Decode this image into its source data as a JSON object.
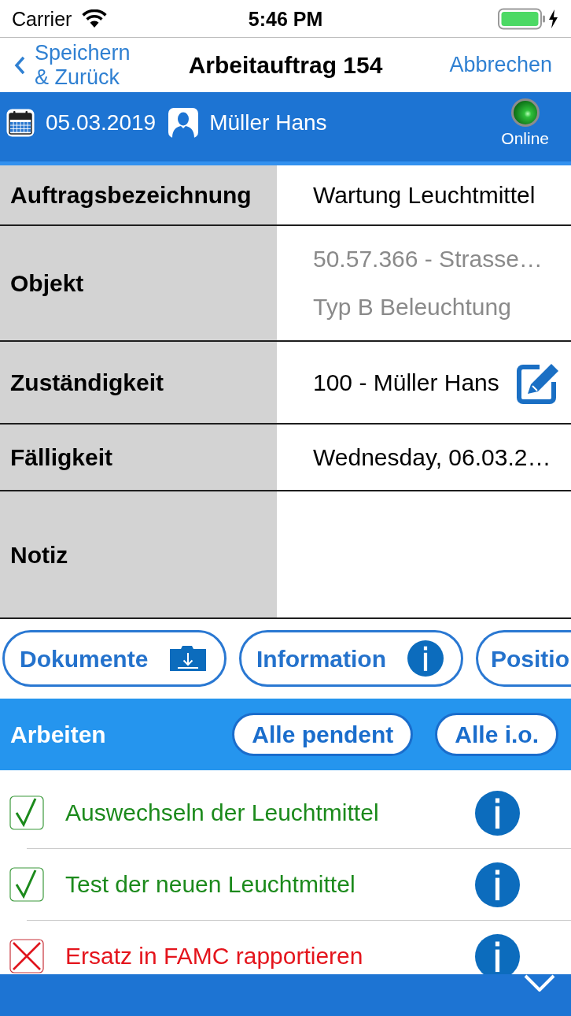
{
  "status_bar": {
    "carrier": "Carrier",
    "time": "5:46 PM"
  },
  "nav": {
    "back": "Speichern & Zurück",
    "title": "Arbeitauftrag 154",
    "cancel": "Abbrechen"
  },
  "header": {
    "date": "05.03.2019",
    "user": "Müller Hans",
    "connection": {
      "label": "Online",
      "online": true
    }
  },
  "fields": [
    {
      "kind": "text",
      "label": "Auftragsbezeichnung",
      "values": [
        "Wartung Leuchtmittel"
      ],
      "disabled": false
    },
    {
      "kind": "multiline",
      "label": "Objekt",
      "values": [
        "50.57.366 - Strasse…",
        "Typ B Beleuchtung"
      ],
      "disabled": true
    },
    {
      "kind": "picker",
      "label": "Zuständigkeit",
      "values": [
        "100 - Müller Hans"
      ],
      "disabled": false
    },
    {
      "kind": "date",
      "label": "Fälligkeit",
      "values": [
        "Wednesday, 06.03.2…"
      ],
      "disabled": false
    },
    {
      "kind": "notes",
      "label": "Notiz",
      "disabled": false
    }
  ],
  "actions": [
    {
      "kind": "documents",
      "label": "Dokumente"
    },
    {
      "kind": "info",
      "label": "Information"
    },
    {
      "kind": "positions",
      "label": "Positio"
    }
  ],
  "works": {
    "title": "Arbeiten",
    "buttons": [
      "Alle pendent",
      "Alle i.o."
    ],
    "items": [
      {
        "label": "Auswechseln der Leuchtmittel",
        "checked": true
      },
      {
        "label": "Test der neuen Leuchtmittel",
        "checked": true
      },
      {
        "label": "Ersatz in FAMC rapportieren",
        "checked": false
      }
    ]
  }
}
